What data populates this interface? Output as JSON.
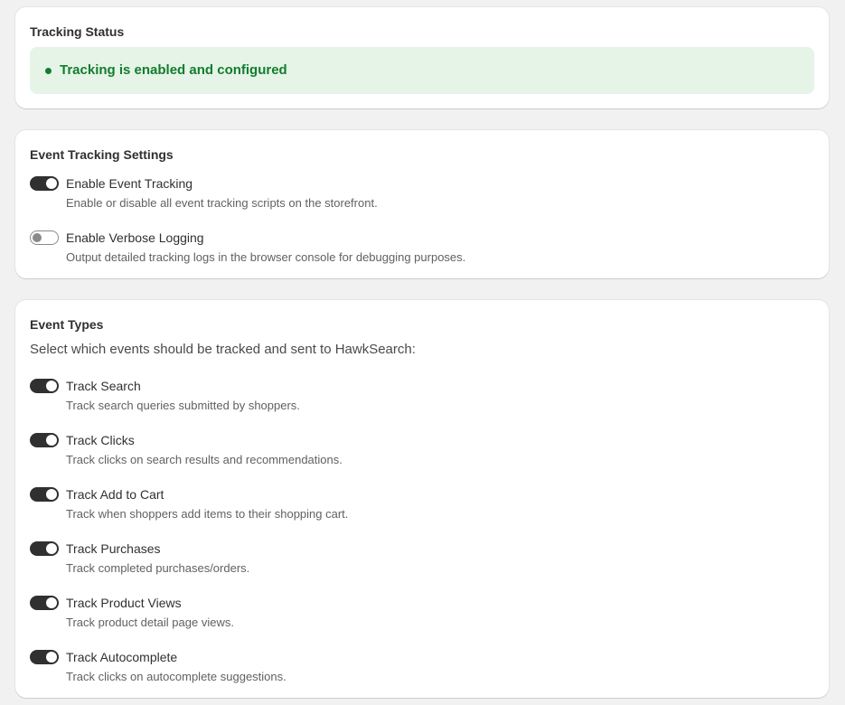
{
  "status_card": {
    "title": "Tracking Status",
    "status_text": "Tracking is enabled and configured",
    "status_color": "#137c2e",
    "banner_color": "#e5f4e7"
  },
  "settings_card": {
    "title": "Event Tracking Settings",
    "items": [
      {
        "label": "Enable Event Tracking",
        "description": "Enable or disable all event tracking scripts on the storefront.",
        "enabled": true
      },
      {
        "label": "Enable Verbose Logging",
        "description": "Output detailed tracking logs in the browser console for debugging purposes.",
        "enabled": false
      }
    ]
  },
  "types_card": {
    "title": "Event Types",
    "intro": "Select which events should be tracked and sent to HawkSearch:",
    "items": [
      {
        "label": "Track Search",
        "description": "Track search queries submitted by shoppers.",
        "enabled": true
      },
      {
        "label": "Track Clicks",
        "description": "Track clicks on search results and recommendations.",
        "enabled": true
      },
      {
        "label": "Track Add to Cart",
        "description": "Track when shoppers add items to their shopping cart.",
        "enabled": true
      },
      {
        "label": "Track Purchases",
        "description": "Track completed purchases/orders.",
        "enabled": true
      },
      {
        "label": "Track Product Views",
        "description": "Track product detail page views.",
        "enabled": true
      },
      {
        "label": "Track Autocomplete",
        "description": "Track clicks on autocomplete suggestions.",
        "enabled": true
      }
    ]
  }
}
